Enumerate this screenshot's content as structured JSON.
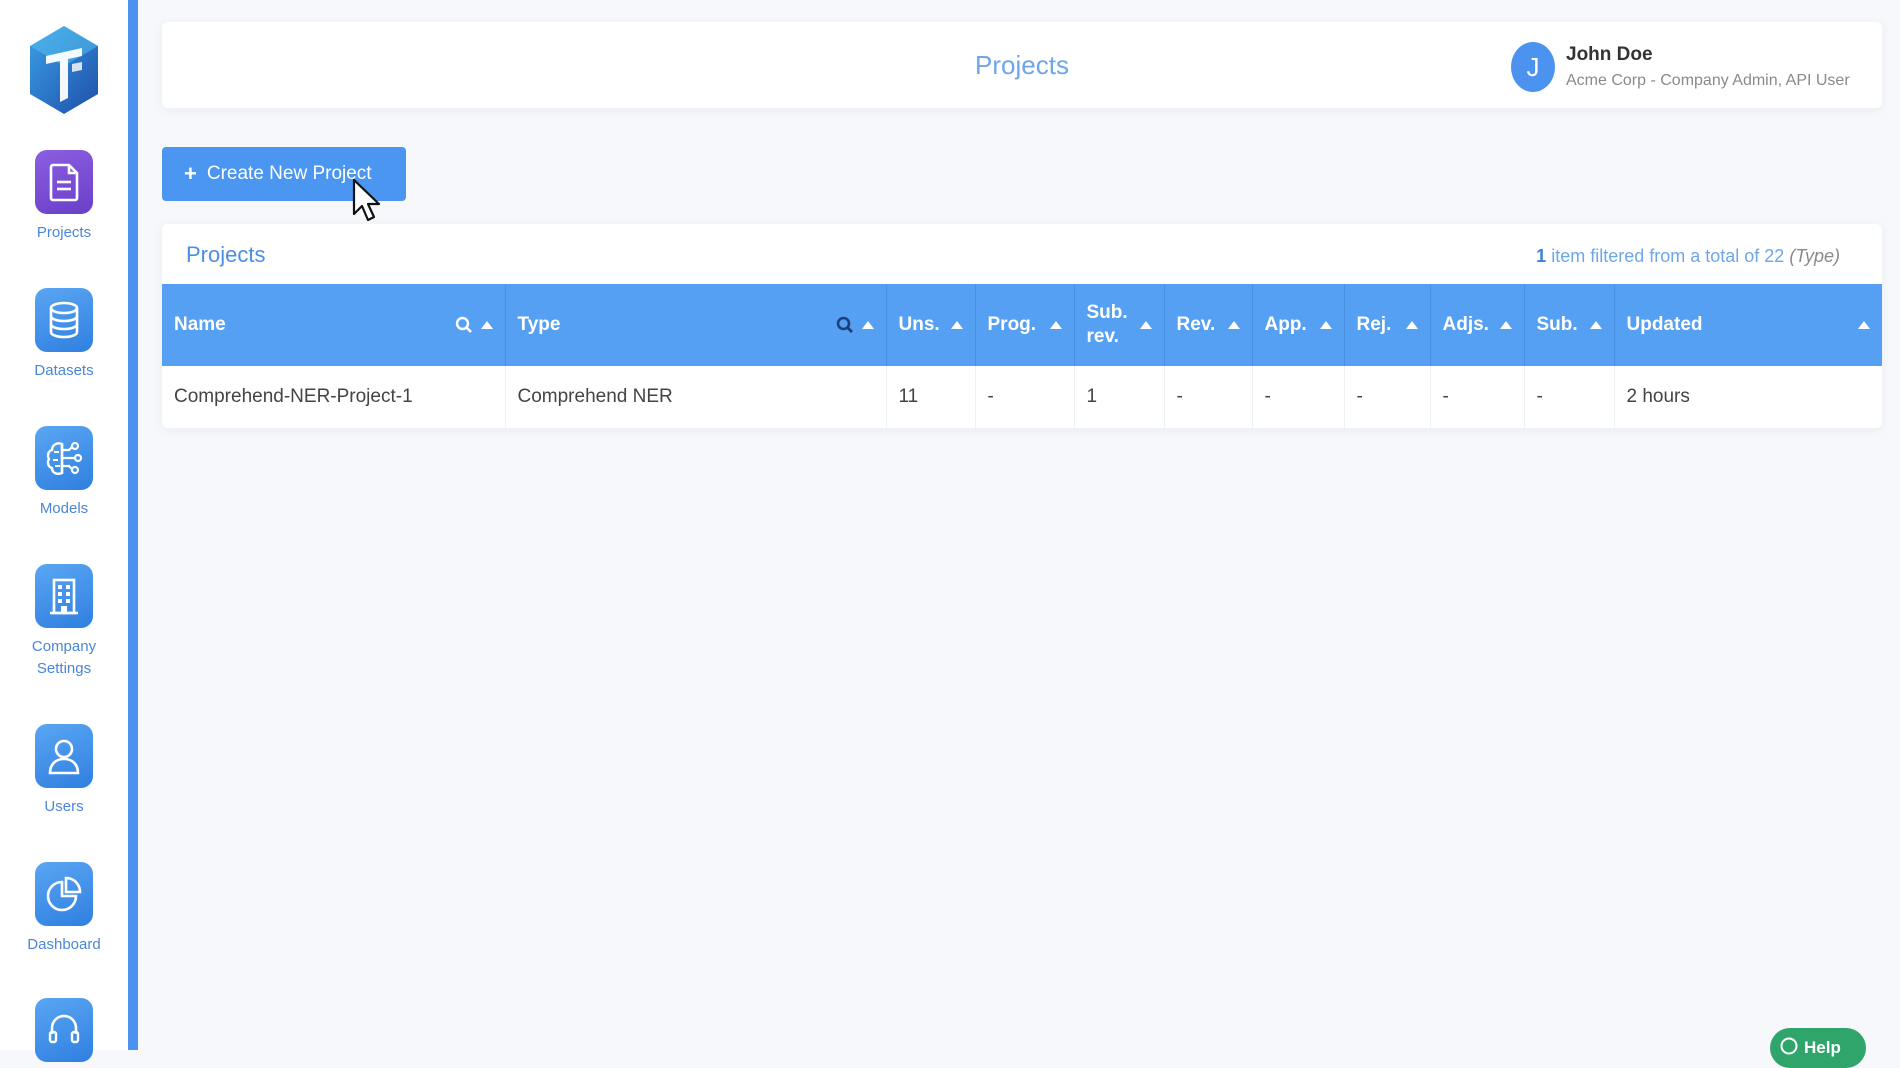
{
  "sidebar": {
    "items": [
      {
        "label": "Projects",
        "icon": "document-icon",
        "active": true
      },
      {
        "label": "Datasets",
        "icon": "database-icon"
      },
      {
        "label": "Models",
        "icon": "brain-icon"
      },
      {
        "label": "Company Settings",
        "icon": "building-icon"
      },
      {
        "label": "Users",
        "icon": "user-icon"
      },
      {
        "label": "Dashboard",
        "icon": "pie-chart-icon"
      },
      {
        "label": "",
        "icon": "headset-icon"
      }
    ]
  },
  "header": {
    "title": "Projects",
    "user": {
      "initial": "J",
      "name": "John Doe",
      "role": "Acme Corp - Company Admin, API User"
    }
  },
  "toolbar": {
    "create_label": "Create New Project",
    "create_icon": "plus-icon"
  },
  "projects_panel": {
    "title": "Projects",
    "summary": {
      "count": "1",
      "text": "item filtered from a total of 22",
      "filter": "(Type)"
    },
    "columns": [
      "Name",
      "Type",
      "Uns.",
      "Prog.",
      "Sub. rev.",
      "Rev.",
      "App.",
      "Rej.",
      "Adjs.",
      "Sub.",
      "Updated"
    ],
    "rows": [
      [
        "Comprehend-NER-Project-1",
        "Comprehend NER",
        "11",
        "-",
        "1",
        "-",
        "-",
        "-",
        "-",
        "-",
        "2 hours"
      ]
    ]
  },
  "help": {
    "label": "Help"
  },
  "colors": {
    "accent": "#4b96f0",
    "header_row": "#56a0f3",
    "active_nav": "#7a4fd6",
    "help": "#2fa56b"
  }
}
